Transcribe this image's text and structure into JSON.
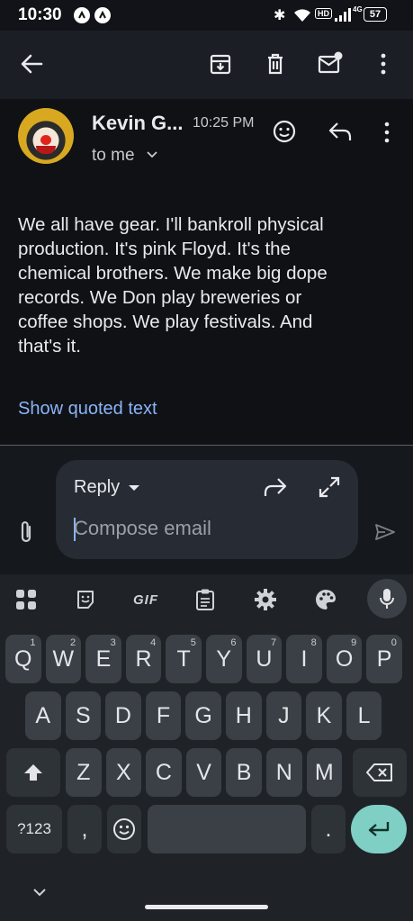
{
  "status": {
    "time": "10:30",
    "battery": "57",
    "network": "4G"
  },
  "email": {
    "sender": "Kevin G...",
    "time": "10:25 PM",
    "recipient": "to me",
    "body_lines": [
      "We all have gear. I'll bankroll physical",
      "production. It's pink Floyd. It's the",
      "chemical brothers. We make big dope",
      "records. We Don play breweries or",
      "coffee shops. We play festivals. And",
      "that's it."
    ],
    "show_quoted": "Show quoted text"
  },
  "reply": {
    "mode_label": "Reply",
    "placeholder": "Compose email"
  },
  "keyboard": {
    "gif_label": "GIF",
    "row1": [
      {
        "k": "Q",
        "h": "1"
      },
      {
        "k": "W",
        "h": "2"
      },
      {
        "k": "E",
        "h": "3"
      },
      {
        "k": "R",
        "h": "4"
      },
      {
        "k": "T",
        "h": "5"
      },
      {
        "k": "Y",
        "h": "6"
      },
      {
        "k": "U",
        "h": "7"
      },
      {
        "k": "I",
        "h": "8"
      },
      {
        "k": "O",
        "h": "9"
      },
      {
        "k": "P",
        "h": "0"
      }
    ],
    "row2": [
      "A",
      "S",
      "D",
      "F",
      "G",
      "H",
      "J",
      "K",
      "L"
    ],
    "row3": [
      "Z",
      "X",
      "C",
      "V",
      "B",
      "N",
      "M"
    ],
    "symbols_label": "?123",
    "comma": ",",
    "period": "."
  },
  "colors": {
    "accent_link": "#8ab4f8",
    "enter_key": "#7fcfc4",
    "caret": "#8ab4f8"
  }
}
